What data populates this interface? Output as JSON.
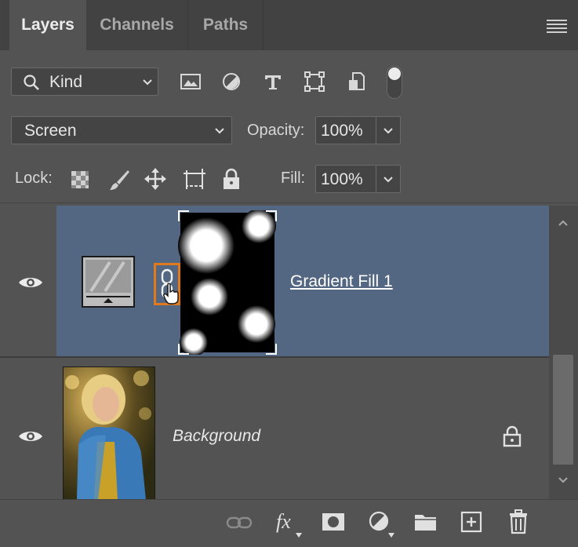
{
  "tabs": [
    {
      "label": "Layers",
      "active": true
    },
    {
      "label": "Channels",
      "active": false
    },
    {
      "label": "Paths",
      "active": false
    }
  ],
  "filter": {
    "kind_label": "Kind",
    "filter_icons": [
      "image-filter-icon",
      "adjustment-filter-icon",
      "type-filter-icon",
      "shape-filter-icon",
      "smart-object-filter-icon",
      "filter-toggle-icon"
    ]
  },
  "blend": {
    "mode": "Screen",
    "opacity_label": "Opacity:",
    "opacity_value": "100%"
  },
  "lock": {
    "label": "Lock:",
    "fill_label": "Fill:",
    "fill_value": "100%",
    "icons": [
      "lock-transparent-pixels-icon",
      "lock-image-pixels-icon",
      "lock-position-icon",
      "lock-artboard-icon",
      "lock-all-icon"
    ]
  },
  "layers": [
    {
      "name": "Gradient Fill 1",
      "selected": true,
      "visible": true
    },
    {
      "name": "Background",
      "selected": false,
      "visible": true,
      "locked": true
    }
  ],
  "bottom_toolbar": [
    "link-layers-icon",
    "fx-icon",
    "layer-mask-icon",
    "adjustment-layer-icon",
    "group-folder-icon",
    "new-layer-icon",
    "trash-icon"
  ],
  "bottom_labels": {
    "fx": "fx"
  },
  "colors": {
    "panel": "#535353",
    "tabbar": "#424242",
    "selected_row": "#546782",
    "highlight": "#e07a1c"
  }
}
